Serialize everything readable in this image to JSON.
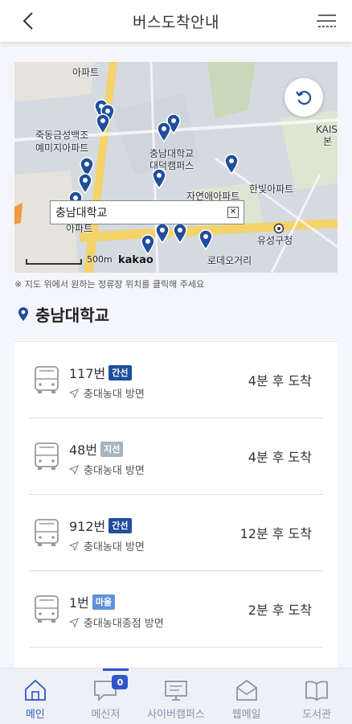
{
  "header": {
    "title": "버스도착안내",
    "back_icon": "chevron-left-icon",
    "menu_icon": "hamburger-menu-icon"
  },
  "map": {
    "labels": {
      "apt_top": "아파트",
      "geumseong_1": "죽동금성백조",
      "geumseong_2": "예미지아파트",
      "cnu_1": "충남대학교",
      "cnu_2": "대덕캠퍼스",
      "kaist_1": "KAIS",
      "kaist_2": "본",
      "hanbit": "한빛아파트",
      "apt_mid": "자연애아파트",
      "apt_left": "아파트",
      "yuseong": "유성구청",
      "rodeo": "로데오거리",
      "scale": "500m",
      "brand": "kakao"
    },
    "selected_stop": "충남대학교",
    "close_symbol": "✕",
    "refresh_icon": "refresh-icon"
  },
  "hint": "※ 지도 위에서 원하는 정류장 위치를 클릭해 주세요",
  "stop": {
    "name": "충남대학교",
    "icon": "location-pin-icon"
  },
  "buses": [
    {
      "number": "117번",
      "type": "간선",
      "type_color": "#1f4e9c",
      "direction": "충대농대 방면",
      "arrival": "4분 후 도착"
    },
    {
      "number": "48번",
      "type": "지선",
      "type_color": "#a5b4bf",
      "direction": "충대농대 방면",
      "arrival": "4분 후 도착"
    },
    {
      "number": "912번",
      "type": "간선",
      "type_color": "#1f4e9c",
      "direction": "충대농대 방면",
      "arrival": "12분 후 도착"
    },
    {
      "number": "1번",
      "type": "마을",
      "type_color": "#5d92d8",
      "direction": "충대농대종점 방면",
      "arrival": "2분 후 도착"
    }
  ],
  "tabs": [
    {
      "label": "메인",
      "icon": "home-icon",
      "active": true
    },
    {
      "label": "메신저",
      "icon": "chat-icon",
      "badge": "0"
    },
    {
      "label": "사이버캠퍼스",
      "icon": "monitor-icon"
    },
    {
      "label": "웹메일",
      "icon": "mail-icon"
    },
    {
      "label": "도서관",
      "icon": "book-icon"
    }
  ],
  "colors": {
    "accent": "#2f56c9",
    "pin": "#1f4e9c"
  }
}
